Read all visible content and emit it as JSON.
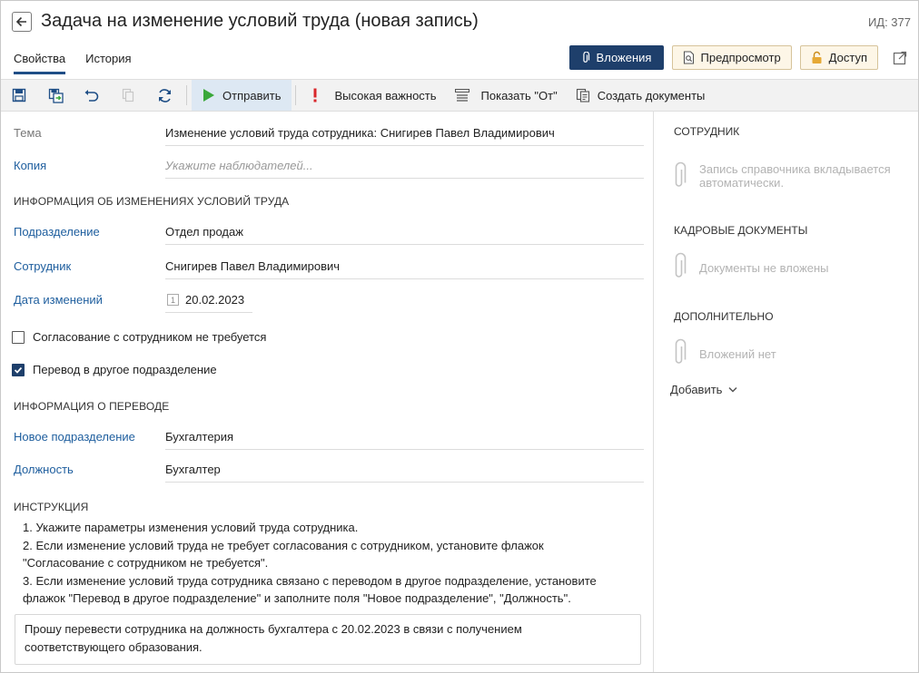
{
  "header": {
    "title": "Задача на изменение условий труда (новая запись)",
    "record_id": "ИД: 377",
    "tabs": [
      {
        "label": "Свойства",
        "active": true
      },
      {
        "label": "История",
        "active": false
      }
    ],
    "buttons": {
      "attachments": "Вложения",
      "preview": "Предпросмотр",
      "access": "Доступ"
    }
  },
  "toolbar": {
    "send": "Отправить",
    "high_importance": "Высокая важность",
    "show_from": "Показать \"От\"",
    "create_documents": "Создать документы"
  },
  "fields": {
    "subject": {
      "label": "Тема",
      "value": "Изменение условий труда сотрудника: Снигирев Павел Владимирович"
    },
    "copy": {
      "label": "Копия",
      "placeholder": "Укажите наблюдателей..."
    }
  },
  "change_info": {
    "section_title": "ИНФОРМАЦИЯ ОБ ИЗМЕНЕНИЯХ УСЛОВИЙ ТРУДА",
    "department": {
      "label": "Подразделение",
      "value": "Отдел продаж"
    },
    "employee": {
      "label": "Сотрудник",
      "value": "Снигирев Павел Владимирович"
    },
    "change_date": {
      "label": "Дата изменений",
      "value": "20.02.2023",
      "calendar_glyph": "1"
    }
  },
  "checkboxes": {
    "no_approval": {
      "label": "Согласование с сотрудником не требуется",
      "checked": false
    },
    "transfer": {
      "label": "Перевод в другое подразделение",
      "checked": true
    }
  },
  "transfer_info": {
    "section_title": "ИНФОРМАЦИЯ О ПЕРЕВОДЕ",
    "new_department": {
      "label": "Новое подразделение",
      "value": "Бухгалтерия"
    },
    "position": {
      "label": "Должность",
      "value": "Бухгалтер"
    }
  },
  "instruction": {
    "section_title": "ИНСТРУКЦИЯ",
    "lines": [
      "1. Укажите параметры изменения условий труда сотрудника.",
      "2. Если изменение условий труда не требует согласования с сотрудником, установите флажок",
      "\"Согласование с сотрудником не требуется\".",
      "3. Если изменение условий труда сотрудника связано с переводом в другое подразделение, установите",
      "флажок \"Перевод в другое подразделение\" и заполните поля \"Новое подразделение\", \"Должность\"."
    ]
  },
  "memo": {
    "line1": "Прошу перевести сотрудника на должность бухгалтера с 20.02.2023 в связи с получением",
    "line2": "соответствующего образования."
  },
  "side_panel": {
    "employee": {
      "title": "СОТРУДНИК",
      "text_line1": "Запись справочника вкладывается",
      "text_line2": "автоматически."
    },
    "hr_docs": {
      "title": "КАДРОВЫЕ ДОКУМЕНТЫ",
      "text": "Документы не вложены"
    },
    "additional": {
      "title": "ДОПОЛНИТЕЛЬНО",
      "text": "Вложений нет"
    },
    "add_label": "Добавить"
  },
  "colors": {
    "primary": "#1e3f6b",
    "link_label": "#1e5e9e",
    "send_green": "#3aa83a",
    "importance_red": "#d9262b",
    "toolbar_bg": "#f2f2f2"
  },
  "icons": [
    "back-arrow-icon",
    "paperclip-icon",
    "preview-icon",
    "lock-icon",
    "expand-icon",
    "save-icon",
    "save-and-close-icon",
    "undo-icon",
    "copy-icon",
    "refresh-icon",
    "play-icon",
    "exclamation-icon",
    "from-list-icon",
    "documents-icon",
    "calendar-icon",
    "check-icon",
    "chevron-down-icon"
  ]
}
